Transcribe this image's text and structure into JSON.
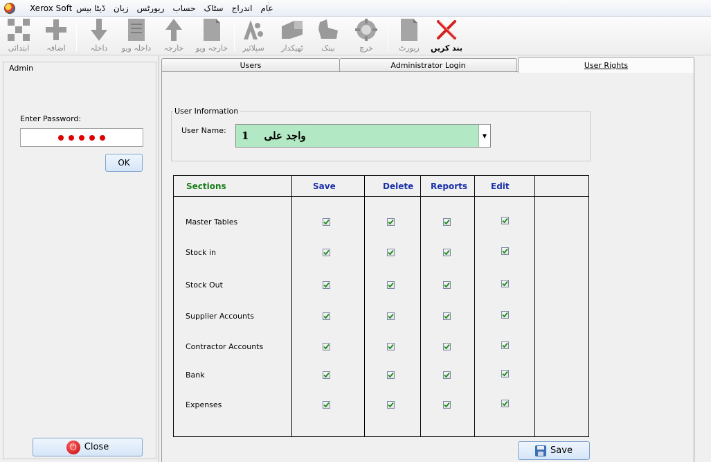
{
  "menubar": {
    "title": "Xerox Soft",
    "items": [
      "عام",
      "اندراج",
      "سٹاک",
      "حساب",
      "ریورٹس",
      "زبان",
      "ڈیٹا بیس"
    ]
  },
  "toolbar": {
    "buttons": [
      {
        "label": "ابتدائی",
        "icon": "grid-icon"
      },
      {
        "label": "اضافہ",
        "icon": "plus-icon"
      },
      {
        "label": "داخلہ",
        "icon": "down-arrow-icon"
      },
      {
        "label": "داخلہ ویو",
        "icon": "document-view-icon"
      },
      {
        "label": "خارجہ",
        "icon": "up-arrow-icon"
      },
      {
        "label": "خارجہ ویو",
        "icon": "document-icon"
      },
      {
        "label": "سپلائیر",
        "icon": "supplier-icon"
      },
      {
        "label": "ٹھیکدار",
        "icon": "contractor-icon"
      },
      {
        "label": "بینک",
        "icon": "bank-icon"
      },
      {
        "label": "خرچ",
        "icon": "expense-icon"
      },
      {
        "label": "رپورٹ",
        "icon": "report-icon"
      },
      {
        "label": "بند کریں",
        "icon": "close-x-icon"
      }
    ]
  },
  "admin": {
    "legend": "Admin",
    "password_label": "Enter Password:",
    "password_length": 5,
    "ok_label": "OK",
    "close_label": "Close"
  },
  "tabs": [
    {
      "label": "Users",
      "active": false
    },
    {
      "label": "Administrator Login",
      "active": false
    },
    {
      "label": "User Rights",
      "active": true
    }
  ],
  "user_info": {
    "legend": "User Information",
    "user_name_label": "User Name:",
    "user_id": "1",
    "user_name": "واجد علی"
  },
  "rights": {
    "headers": {
      "sections": "Sections",
      "save": "Save",
      "delete": "Delete",
      "reports": "Reports",
      "edit": "Edit"
    },
    "rows": [
      {
        "section": "Master Tables",
        "save": true,
        "delete": true,
        "reports": true,
        "edit": true
      },
      {
        "section": "Stock in",
        "save": true,
        "delete": true,
        "reports": true,
        "edit": true
      },
      {
        "section": "Stock Out",
        "save": true,
        "delete": true,
        "reports": true,
        "edit": true
      },
      {
        "section": "Supplier Accounts",
        "save": true,
        "delete": true,
        "reports": true,
        "edit": true
      },
      {
        "section": "Contractor Accounts",
        "save": true,
        "delete": true,
        "reports": true,
        "edit": true
      },
      {
        "section": "Bank",
        "save": true,
        "delete": true,
        "reports": true,
        "edit": true
      },
      {
        "section": "Expenses",
        "save": true,
        "delete": true,
        "reports": true,
        "edit": true
      }
    ]
  },
  "save_label": "Save",
  "colors": {
    "accent_green": "#1a7d1a",
    "header_blue": "#1a2fa8",
    "combo_bg": "#b3e8c4",
    "password_dot": "#e00000"
  }
}
